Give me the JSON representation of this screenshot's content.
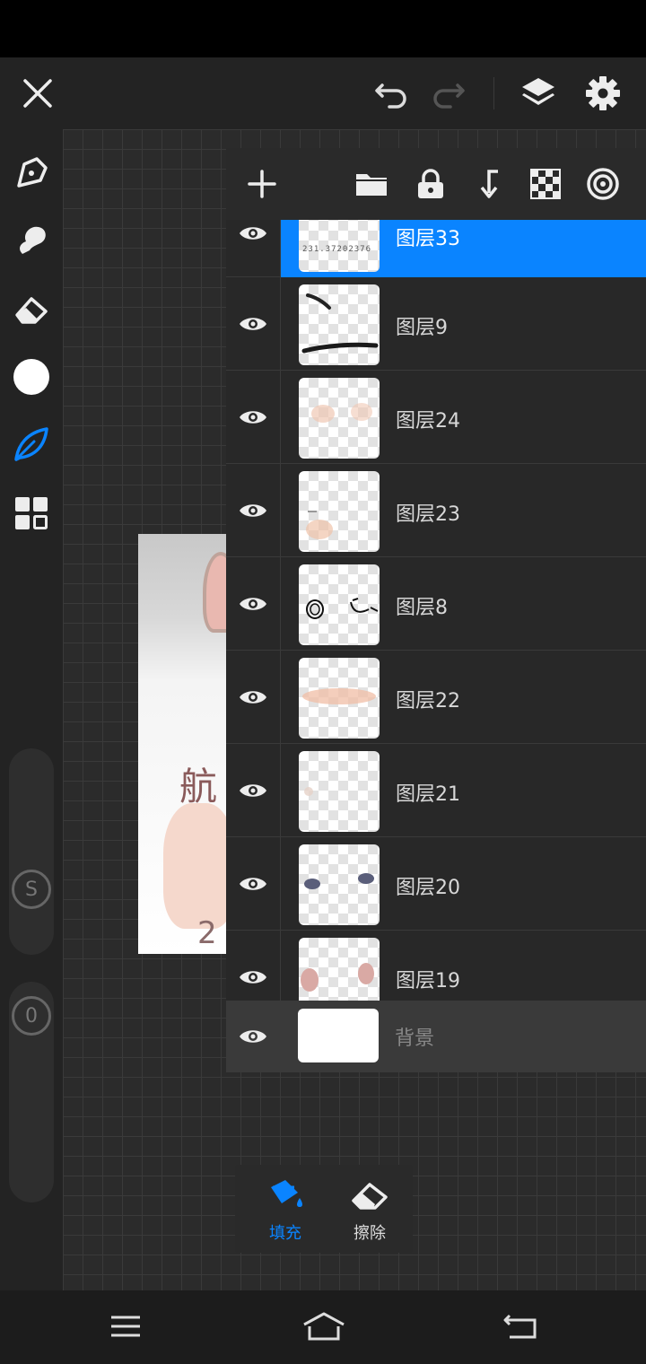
{
  "layers_panel": {
    "layers": [
      {
        "name": "图层33",
        "selected": true,
        "thumb_text": "231.37202376"
      },
      {
        "name": "图层9",
        "selected": false
      },
      {
        "name": "图层24",
        "selected": false
      },
      {
        "name": "图层23",
        "selected": false
      },
      {
        "name": "图层8",
        "selected": false
      },
      {
        "name": "图层22",
        "selected": false
      },
      {
        "name": "图层21",
        "selected": false
      },
      {
        "name": "图层20",
        "selected": false
      },
      {
        "name": "图层19",
        "selected": false
      }
    ],
    "background_layer": {
      "name": "背景"
    }
  },
  "artwork": {
    "glyph": "航",
    "digit": "2"
  },
  "left_toolbar": {
    "slider_size_label": "S",
    "slider_opacity_label": "0"
  },
  "fill_popup": {
    "fill_label": "填充",
    "erase_label": "擦除"
  },
  "colors": {
    "accent": "#0a84ff",
    "icon": "#ededed",
    "panel": "#282828"
  }
}
